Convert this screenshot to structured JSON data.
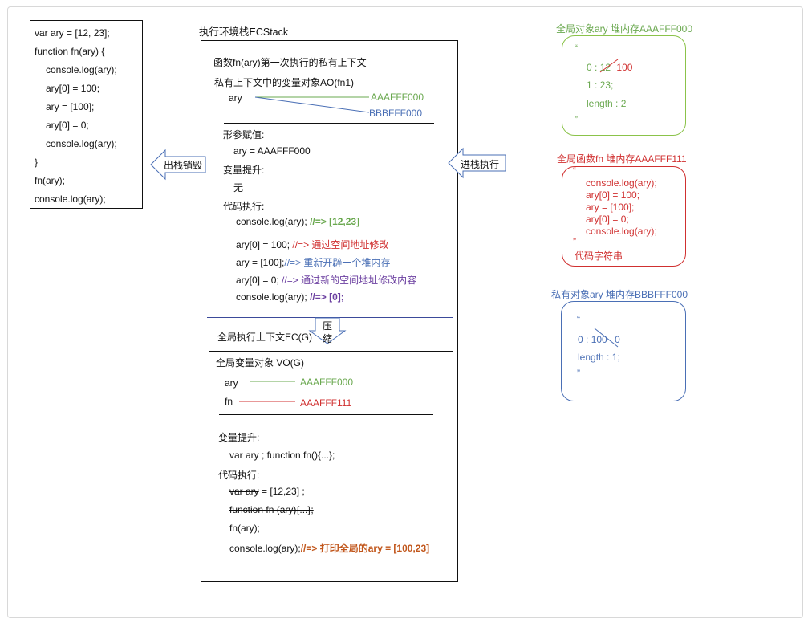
{
  "code": [
    "var ary = [12, 23];",
    "function fn(ary) {",
    "console.log(ary);",
    "ary[0] = 100;",
    "ary = [100];",
    "ary[0] = 0;",
    "console.log(ary);",
    "}",
    "fn(ary);",
    "console.log(ary);"
  ],
  "ecstack_title": "执行环境栈ECStack",
  "fn_ctx": {
    "title": "函数fn(ary)第一次执行的私有上下文",
    "ao_title": "私有上下文中的变量对象AO(fn1)",
    "ary_label": "ary",
    "addr_old": "AAAFFF000",
    "addr_new": "BBBFFF000",
    "param_title": "形参赋值:",
    "param_value": "ary = AAAFFF000",
    "hoist_title": "变量提升:",
    "hoist_value": "无",
    "exec_title": "代码执行:",
    "lines": [
      {
        "code": "console.log(ary);",
        "comment": "//=> [12,23]"
      },
      {
        "code": "ary[0] = 100;",
        "comment": "//=> 通过空间地址修改"
      },
      {
        "code": "ary = [100];",
        "comment": "//=> 重新开辟一个堆内存"
      },
      {
        "code": "ary[0] = 0;",
        "comment": "//=> 通过新的空间地址修改内容"
      },
      {
        "code": "console.log(ary);",
        "comment": "//=> [0];"
      }
    ]
  },
  "compress_label_1": "压",
  "compress_label_2": "缩",
  "global_ctx": {
    "title": "全局执行上下文EC(G)",
    "vo_title": "全局变量对象 VO(G)",
    "ary_label": "ary",
    "ary_addr": "AAAFFF000",
    "fn_label": "fn",
    "fn_addr": "AAAFFF111",
    "hoist_title": "变量提升:",
    "hoist_value": "var ary ;  function fn(){...};",
    "exec_title": "代码执行:",
    "line1_struck": "var ary",
    "line1_rest": " = [12,23] ;",
    "line2_struck": "function fn (ary){...};",
    "line3": "fn(ary);",
    "line4_code": "console.log(ary);",
    "line4_comment": "//=> 打印全局的ary = [100,23]"
  },
  "exit_label": "出栈销毁",
  "enter_label": "进栈执行",
  "heap_ary": {
    "title": "全局对象ary 堆内存AAAFFF000",
    "open_quote": "“",
    "row0_key": "0 : ",
    "row0_old": "12",
    "row0_new": "100",
    "row1": "1 : 23;",
    "row2": "length : 2",
    "close_quote": "”"
  },
  "heap_fn": {
    "title": "全局函数fn 堆内存AAAFFF111",
    "open_quote": "“",
    "lines": [
      "console.log(ary);",
      "ary[0] = 100;",
      "ary = [100];",
      "ary[0] = 0;",
      "console.log(ary);"
    ],
    "close_quote": "”",
    "footer": "代码字符串"
  },
  "heap_private": {
    "title": "私有对象ary 堆内存BBBFFF000",
    "open_quote": "“",
    "row0_key": "0 : ",
    "row0_old": "100",
    "row0_new": "0",
    "row1": "length : 1;",
    "close_quote": "”"
  },
  "colors": {
    "green": "#6aa84f",
    "blue": "#4a6fb5",
    "red": "#d03030",
    "purple": "#6b3fa0",
    "brown": "#c1561b"
  }
}
